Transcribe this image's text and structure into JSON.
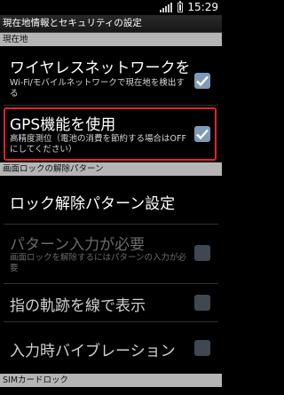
{
  "status_bar": {
    "time": "15:29"
  },
  "title_bar": {
    "title": "現在地情報とセキュリティの設定"
  },
  "sections": [
    {
      "label": "現在地"
    },
    {
      "label": "画面ロックの解除パターン"
    },
    {
      "label": "SIMカードロック"
    }
  ],
  "location": {
    "wireless": {
      "title": "ワイヤレスネットワークを",
      "summary": "Wi-Fi/モバイルネットワークで現在地を検出する",
      "checked": true
    },
    "gps": {
      "title": "GPS機能を使用",
      "summary": "高精度測位（電池の消費を節約する場合はOFFにしてください）",
      "checked": true
    }
  },
  "unlock": {
    "set_pattern": {
      "title": "ロック解除パターン設定"
    },
    "require_pattern": {
      "title": "パターン入力が必要",
      "summary": "画面ロックを解除するにはパターンの入力が必要",
      "enabled": false
    },
    "visible_pattern": {
      "title": "指の軌跡を線で表示",
      "enabled": false
    },
    "tactile_feedback": {
      "title": "入力時バイブレーション",
      "enabled": false
    }
  },
  "colors": {
    "highlight": "#e4222a",
    "checkbox_active": "#7e9ab6",
    "checkbox_disabled": "#3f4752",
    "section_header": "#b5b5b5"
  }
}
